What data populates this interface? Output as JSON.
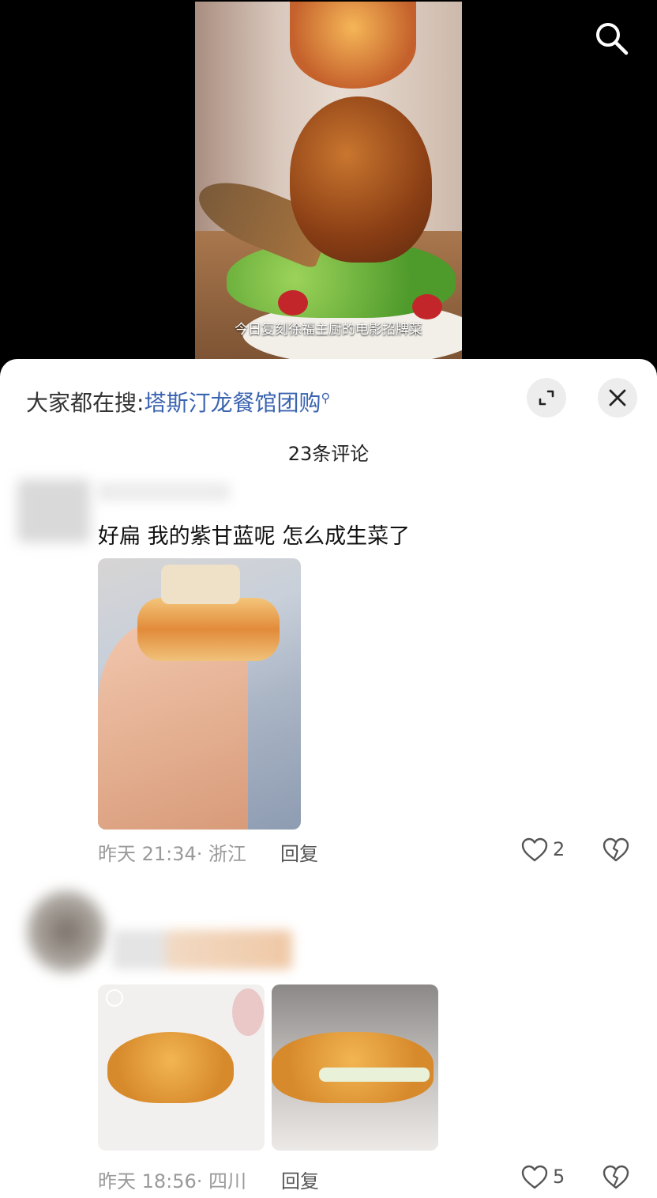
{
  "video": {
    "subtitle": "今日复刻徐福主厨的电影招牌菜"
  },
  "sheet": {
    "search_prefix": "大家都在搜:",
    "search_term": "塔斯汀龙餐馆团购",
    "comment_count": "23条评论"
  },
  "comments": [
    {
      "text": "好扁 我的紫甘蓝呢 怎么成生菜了",
      "time": "昨天 21:34",
      "location": "· 浙江",
      "reply_label": "回复",
      "likes": "2"
    },
    {
      "text": "",
      "time": "昨天 18:56",
      "location": "· 四川",
      "reply_label": "回复",
      "likes": "5"
    }
  ],
  "icons": {
    "search": "search-icon",
    "expand": "expand-icon",
    "close": "close-icon",
    "like": "heart-icon",
    "dislike": "broken-heart-icon"
  },
  "colors": {
    "accent_link": "#3a63b0",
    "meta_gray": "#9a9a9a"
  }
}
